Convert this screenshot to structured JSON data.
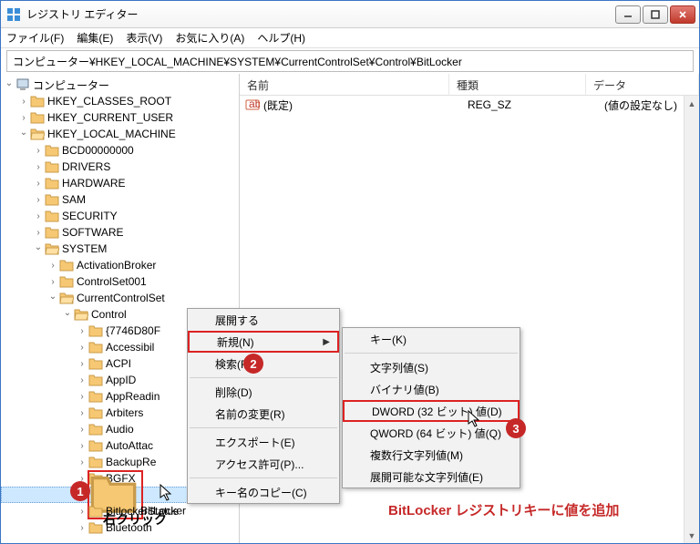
{
  "window": {
    "title": "レジストリ エディター"
  },
  "menubar": [
    "ファイル(F)",
    "編集(E)",
    "表示(V)",
    "お気に入り(A)",
    "ヘルプ(H)"
  ],
  "address": "コンピューター¥HKEY_LOCAL_MACHINE¥SYSTEM¥CurrentControlSet¥Control¥BitLocker",
  "list": {
    "headers": {
      "name": "名前",
      "type": "種類",
      "data": "データ"
    },
    "rows": [
      {
        "name": "(既定)",
        "type": "REG_SZ",
        "data": "(値の設定なし)"
      }
    ]
  },
  "tree": [
    {
      "label": "コンピューター",
      "indent": 0,
      "exp": "v",
      "icon": "computer"
    },
    {
      "label": "HKEY_CLASSES_ROOT",
      "indent": 1,
      "exp": ">"
    },
    {
      "label": "HKEY_CURRENT_USER",
      "indent": 1,
      "exp": ">"
    },
    {
      "label": "HKEY_LOCAL_MACHINE",
      "indent": 1,
      "exp": "v"
    },
    {
      "label": "BCD00000000",
      "indent": 2,
      "exp": ">"
    },
    {
      "label": "DRIVERS",
      "indent": 2,
      "exp": ">"
    },
    {
      "label": "HARDWARE",
      "indent": 2,
      "exp": ">"
    },
    {
      "label": "SAM",
      "indent": 2,
      "exp": ">"
    },
    {
      "label": "SECURITY",
      "indent": 2,
      "exp": ">"
    },
    {
      "label": "SOFTWARE",
      "indent": 2,
      "exp": ">"
    },
    {
      "label": "SYSTEM",
      "indent": 2,
      "exp": "v"
    },
    {
      "label": "ActivationBroker",
      "indent": 3,
      "exp": ">"
    },
    {
      "label": "ControlSet001",
      "indent": 3,
      "exp": ">"
    },
    {
      "label": "CurrentControlSet",
      "indent": 3,
      "exp": "v"
    },
    {
      "label": "Control",
      "indent": 4,
      "exp": "v"
    },
    {
      "label": "{7746D80F",
      "indent": 5,
      "exp": ">"
    },
    {
      "label": "Accessibil",
      "indent": 5,
      "exp": ">"
    },
    {
      "label": "ACPI",
      "indent": 5,
      "exp": ">"
    },
    {
      "label": "AppID",
      "indent": 5,
      "exp": ">"
    },
    {
      "label": "AppReadin",
      "indent": 5,
      "exp": ">"
    },
    {
      "label": "Arbiters",
      "indent": 5,
      "exp": ">"
    },
    {
      "label": "Audio",
      "indent": 5,
      "exp": ">"
    },
    {
      "label": "AutoAttac",
      "indent": 5,
      "exp": ">"
    },
    {
      "label": "BackupRe",
      "indent": 5,
      "exp": ">"
    },
    {
      "label": "BGFX",
      "indent": 5,
      "exp": ">"
    },
    {
      "label": "BitLocker",
      "indent": 5,
      "exp": "",
      "selected": true
    },
    {
      "label": "BitlockerStatus",
      "indent": 5,
      "exp": ">"
    },
    {
      "label": "Bluetooth",
      "indent": 5,
      "exp": ">"
    }
  ],
  "context1": {
    "items": [
      {
        "label": "展開する",
        "sub": false
      },
      {
        "label": "新規(N)",
        "sub": true,
        "highlight": true
      },
      {
        "label": "検索(F)...",
        "sub": false
      },
      {
        "sep": true
      },
      {
        "label": "削除(D)",
        "sub": false
      },
      {
        "label": "名前の変更(R)",
        "sub": false
      },
      {
        "sep": true
      },
      {
        "label": "エクスポート(E)",
        "sub": false
      },
      {
        "label": "アクセス許可(P)...",
        "sub": false
      },
      {
        "sep": true
      },
      {
        "label": "キー名のコピー(C)",
        "sub": false
      }
    ]
  },
  "context2": {
    "items": [
      {
        "label": "キー(K)"
      },
      {
        "sep": true
      },
      {
        "label": "文字列値(S)"
      },
      {
        "label": "バイナリ値(B)"
      },
      {
        "label": "DWORD (32 ビット) 値(D)",
        "highlight": true
      },
      {
        "label": "QWORD (64 ビット) 値(Q)"
      },
      {
        "label": "複数行文字列値(M)"
      },
      {
        "label": "展開可能な文字列値(E)"
      }
    ]
  },
  "annotations": {
    "badge1": "1",
    "badge2": "2",
    "badge3": "3",
    "rightclick": "右クリック",
    "footer": "BitLocker レジストリキーに値を追加"
  }
}
